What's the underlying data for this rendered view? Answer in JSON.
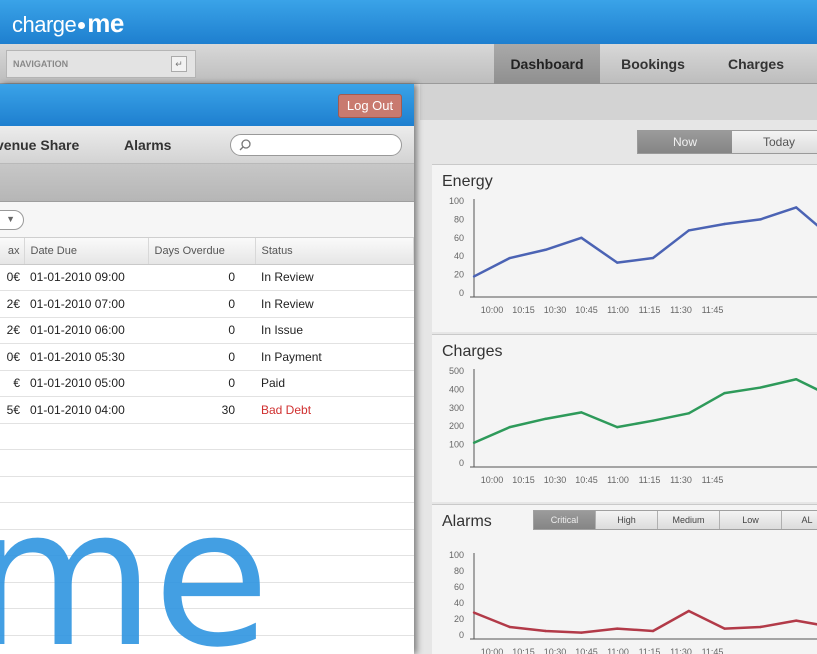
{
  "back": {
    "brand": {
      "prefix": "charge",
      "suffix": "me"
    },
    "nav_label": "NAVIGATION",
    "nav_pin": "↵",
    "tabs": [
      {
        "label": "Dashboard",
        "active": true
      },
      {
        "label": "Bookings",
        "active": false
      },
      {
        "label": "Charges",
        "active": false
      }
    ],
    "time_range": {
      "options": [
        "Now",
        "Today"
      ],
      "selected": "Now"
    },
    "alarm_filter": {
      "options": [
        "Critical",
        "High",
        "Medium",
        "Low",
        "AL"
      ],
      "selected": "Critical"
    }
  },
  "front": {
    "logout_label": "Log Out",
    "nav": [
      "venue Share",
      "Alarms"
    ],
    "search_placeholder": "",
    "table": {
      "headers": [
        "ax",
        "Date Due",
        "Days Overdue",
        "Status"
      ],
      "rows": [
        {
          "tax": "0€",
          "date": "01-01-2010 09:00",
          "overdue": "0",
          "status": "In Review",
          "bad": false
        },
        {
          "tax": "2€",
          "date": "01-01-2010 07:00",
          "overdue": "0",
          "status": "In Review",
          "bad": false
        },
        {
          "tax": "2€",
          "date": "01-01-2010 06:00",
          "overdue": "0",
          "status": "In Issue",
          "bad": false
        },
        {
          "tax": "0€",
          "date": "01-01-2010 05:30",
          "overdue": "0",
          "status": "In Payment",
          "bad": false
        },
        {
          "tax": "€",
          "date": "01-01-2010 05:00",
          "overdue": "0",
          "status": "Paid",
          "bad": false
        },
        {
          "tax": "5€",
          "date": "01-01-2010 04:00",
          "overdue": "30",
          "status": "Bad Debt",
          "bad": true
        }
      ]
    },
    "watermark": "me"
  },
  "colors": {
    "accent_blue": "#2f95e1",
    "energy_line": "#4b63b4",
    "charges_line": "#2e9a5a",
    "alarms_line": "#b23a48",
    "bad_debt": "#d03030"
  },
  "chart_data": [
    {
      "type": "line",
      "title": "Energy",
      "x": [
        "10:00",
        "10:15",
        "10:30",
        "10:45",
        "11:00",
        "11:15",
        "11:30",
        "11:45"
      ],
      "series": [
        {
          "values": [
            18,
            38,
            47,
            60,
            33,
            38,
            68,
            75,
            80,
            93,
            60
          ]
        }
      ],
      "ylim": [
        0,
        100
      ],
      "yticks": [
        100,
        80,
        60,
        40,
        20,
        0
      ]
    },
    {
      "type": "line",
      "title": "Charges",
      "x": [
        "10:00",
        "10:15",
        "10:30",
        "10:45",
        "11:00",
        "11:15",
        "11:30",
        "11:45"
      ],
      "series": [
        {
          "values": [
            110,
            195,
            240,
            275,
            195,
            230,
            270,
            380,
            410,
            455,
            360
          ]
        }
      ],
      "ylim": [
        0,
        500
      ],
      "yticks": [
        500,
        400,
        300,
        200,
        100,
        0
      ]
    },
    {
      "type": "line",
      "title": "Alarms",
      "x": [
        "10:00",
        "10:15",
        "10:30",
        "10:45",
        "11:00",
        "11:15",
        "11:30",
        "11:45"
      ],
      "series": [
        {
          "values": [
            28,
            10,
            5,
            3,
            8,
            5,
            30,
            8,
            10,
            18,
            10
          ]
        }
      ],
      "ylim": [
        0,
        100
      ],
      "yticks": [
        100,
        80,
        60,
        40,
        20,
        0
      ]
    }
  ]
}
